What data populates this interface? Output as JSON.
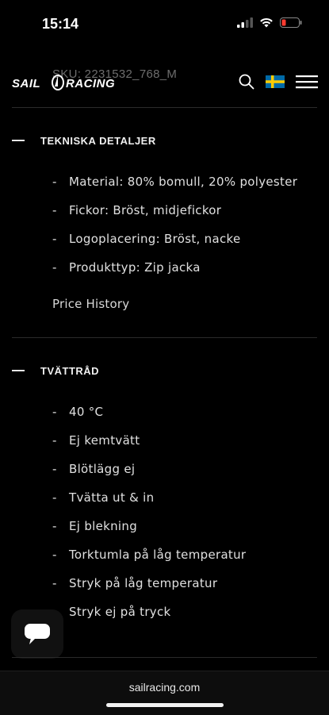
{
  "status": {
    "time": "15:14"
  },
  "header": {
    "sku": "SKU: 2231532_768_M",
    "logo_text": "SAIL RACING"
  },
  "sections": [
    {
      "title": "TEKNISKA DETALJER",
      "items": [
        {
          "bullet": "-",
          "text": "Material: 80% bomull, 20% polyester"
        },
        {
          "bullet": "-",
          "text": "Fickor: Bröst, midjefickor"
        },
        {
          "bullet": "-",
          "text": "Logoplacering: Bröst, nacke"
        },
        {
          "bullet": "-",
          "text": "Produkttyp: Zip jacka"
        }
      ],
      "link": "Price History"
    },
    {
      "title": "TVÄTTRÅD",
      "items": [
        {
          "bullet": "-",
          "text": "40 °C"
        },
        {
          "bullet": "-",
          "text": "Ej kemtvätt"
        },
        {
          "bullet": "-",
          "text": "Blötlägg ej"
        },
        {
          "bullet": "-",
          "text": "Tvätta ut & in"
        },
        {
          "bullet": "-",
          "text": "Ej blekning"
        },
        {
          "bullet": "-",
          "text": "Torktumla på låg temperatur"
        },
        {
          "bullet": "-",
          "text": "Stryk på låg temperatur"
        },
        {
          "bullet": "",
          "text": "Stryk ej på tryck"
        }
      ]
    }
  ],
  "browser": {
    "url": "sailracing.com"
  },
  "colors": {
    "background": "#000000",
    "text": "#e8e8e8",
    "flag_blue": "#006aa7",
    "flag_yellow": "#fecc00",
    "battery_low": "#ff3b30"
  }
}
